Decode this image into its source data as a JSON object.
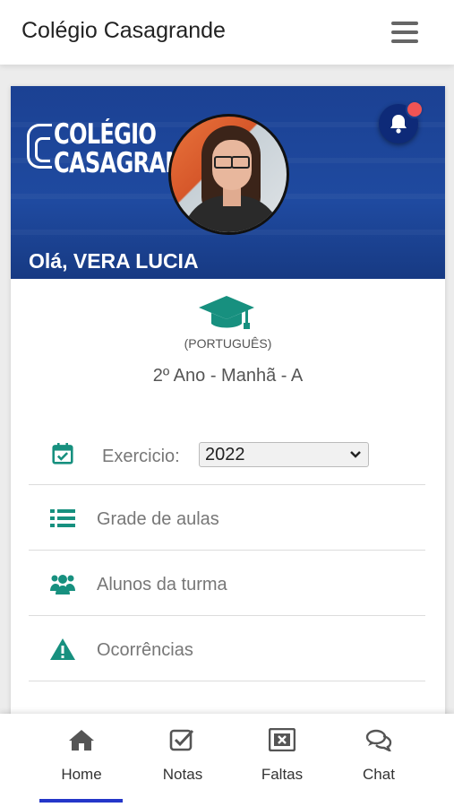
{
  "app": {
    "title": "Colégio Casagrande",
    "menu_icon": "hamburger-icon"
  },
  "banner": {
    "logo_line1": "COLÉGIO",
    "logo_line2": "CASAGRANDE",
    "greeting": "Olá, VERA LUCIA",
    "bell_icon": "bell-icon",
    "has_notification": true,
    "bg_color": "#1f4aa0"
  },
  "profile": {
    "subject": "(PORTUGUÊS)",
    "class_info": "2º Ano - Manhã - A",
    "cap_icon": "graduation-cap-icon",
    "accent_color": "#17907f"
  },
  "menu": {
    "exercise_label": "Exercicio:",
    "exercise_value": "2022",
    "items": [
      {
        "label": "Grade de aulas",
        "icon": "list-icon"
      },
      {
        "label": "Alunos da turma",
        "icon": "users-icon"
      },
      {
        "label": "Ocorrências",
        "icon": "warning-icon"
      }
    ]
  },
  "nav": {
    "items": [
      {
        "label": "Home",
        "icon": "home-icon",
        "active": true
      },
      {
        "label": "Notas",
        "icon": "check-square-icon",
        "active": false
      },
      {
        "label": "Faltas",
        "icon": "x-square-icon",
        "active": false
      },
      {
        "label": "Chat",
        "icon": "chat-icon",
        "active": false
      }
    ],
    "active_color": "#2436c9"
  }
}
